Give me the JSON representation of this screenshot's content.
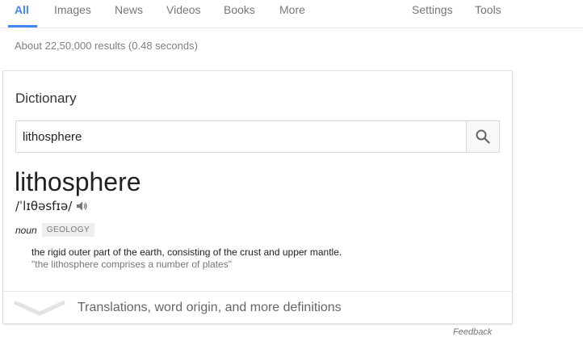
{
  "tabs": [
    {
      "label": "All",
      "active": true
    },
    {
      "label": "Images"
    },
    {
      "label": "News"
    },
    {
      "label": "Videos"
    },
    {
      "label": "Books"
    },
    {
      "label": "More"
    },
    {
      "label": "Settings"
    },
    {
      "label": "Tools"
    }
  ],
  "results_stats": "About 22,50,000 results (0.48 seconds)",
  "dictionary": {
    "title": "Dictionary",
    "search_value": "lithosphere",
    "headword": "lithosphere",
    "pronunciation": "/ˈlɪθəsfɪə/",
    "part_of_speech": "noun",
    "subject_label": "GEOLOGY",
    "definition": "the rigid outer part of the earth, consisting of the crust and upper mantle.",
    "example": "\"the lithosphere comprises a number of plates\"",
    "footer_link": "Translations, word origin, and more definitions"
  },
  "feedback": "Feedback",
  "colors": {
    "accent": "#4285f4",
    "muted_text": "#777777",
    "border": "#dfdfdf"
  },
  "icons": {
    "search_button": "search-icon",
    "speaker": "speaker-icon",
    "expand": "chevron-down-icon"
  }
}
